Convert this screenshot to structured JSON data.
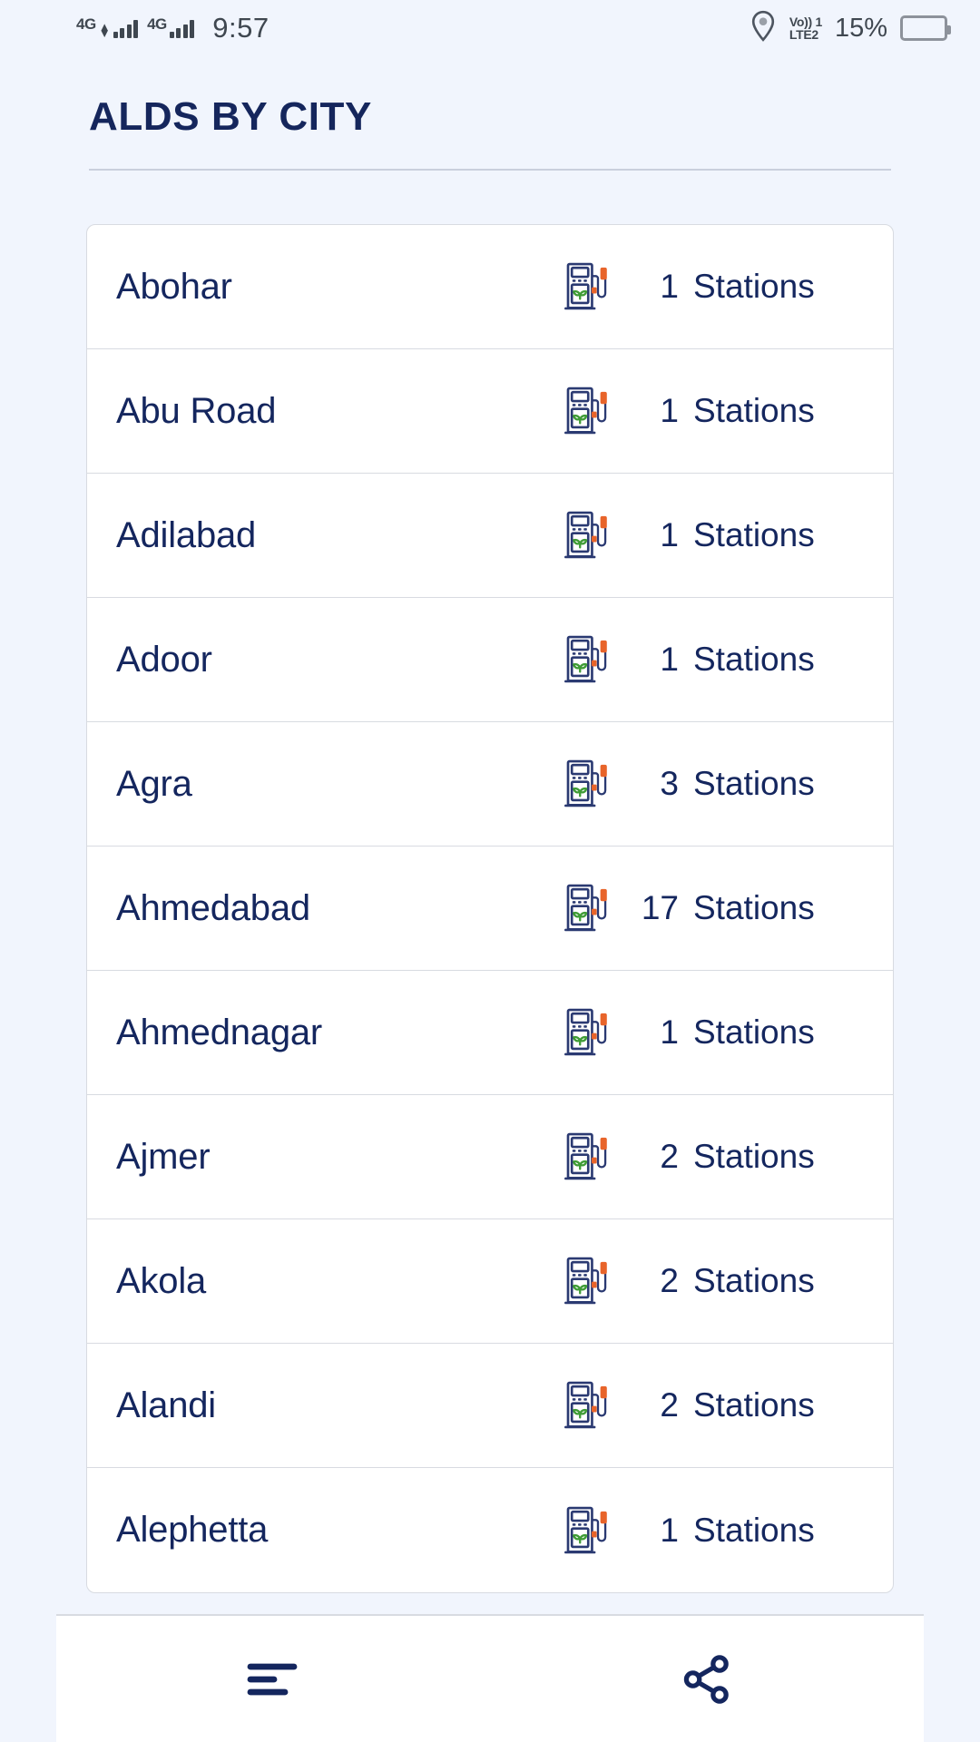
{
  "statusbar": {
    "network_1": {
      "icon": "signal-4g-icon",
      "label": "4G"
    },
    "network_2": {
      "icon": "signal-4g-icon",
      "label": "4G"
    },
    "time": "9:57",
    "location_icon": "location-pin-icon",
    "volte_line1": "Vo)) 1",
    "volte_line2": "LTE2",
    "battery_percent": "15%",
    "battery_icon": "battery-icon"
  },
  "header": {
    "title": "ALDS BY CITY"
  },
  "list": {
    "unit_label": "Stations",
    "pump_icon": "eco-fuel-pump-icon",
    "rows": [
      {
        "city": "Abohar",
        "count": "1"
      },
      {
        "city": "Abu Road",
        "count": "1"
      },
      {
        "city": "Adilabad",
        "count": "1"
      },
      {
        "city": "Adoor",
        "count": "1"
      },
      {
        "city": "Agra",
        "count": "3"
      },
      {
        "city": "Ahmedabad",
        "count": "17"
      },
      {
        "city": "Ahmednagar",
        "count": "1"
      },
      {
        "city": "Ajmer",
        "count": "2"
      },
      {
        "city": "Akola",
        "count": "2"
      },
      {
        "city": "Alandi",
        "count": "2"
      },
      {
        "city": "Alephetta",
        "count": "1"
      }
    ]
  },
  "bottombar": {
    "menu_icon": "list-menu-icon",
    "share_icon": "share-icon"
  },
  "colors": {
    "background": "#f1f5fd",
    "card": "#ffffff",
    "text_navy": "#14265e",
    "border": "#d8dbe1",
    "icon_green": "#3f9c35",
    "icon_orange": "#e8642a"
  }
}
